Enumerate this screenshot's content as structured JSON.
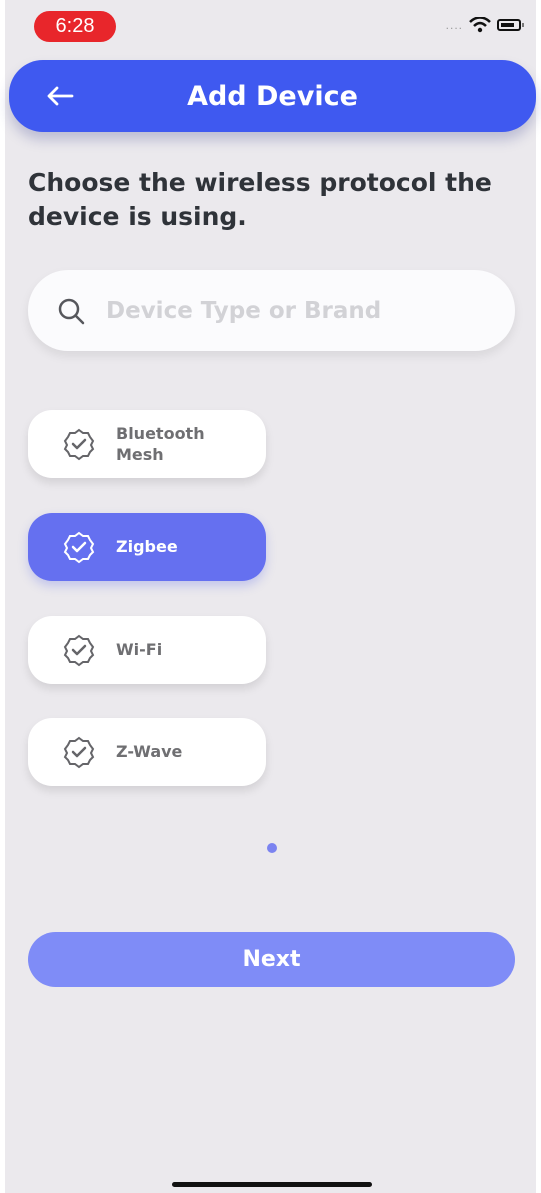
{
  "status_bar": {
    "time": "6:28",
    "signal_text": "....",
    "accent_color": "#e8262b"
  },
  "header": {
    "title": "Add Device",
    "back_icon": "arrow-left-icon",
    "color": "#3f59f0"
  },
  "prompt": "Choose the wireless protocol the device is using.",
  "search": {
    "placeholder": "Device Type or Brand",
    "icon": "search-icon"
  },
  "protocols": [
    {
      "label": "Bluetooth\nMesh",
      "icon": "badge-check-icon",
      "selected": false
    },
    {
      "label": "Zigbee",
      "icon": "badge-check-icon",
      "selected": true
    },
    {
      "label": "Wi-Fi",
      "icon": "badge-check-icon",
      "selected": false
    },
    {
      "label": "Z-Wave",
      "icon": "badge-check-icon",
      "selected": false
    }
  ],
  "next_button": {
    "label": "Next",
    "color": "#7f8cf7"
  }
}
